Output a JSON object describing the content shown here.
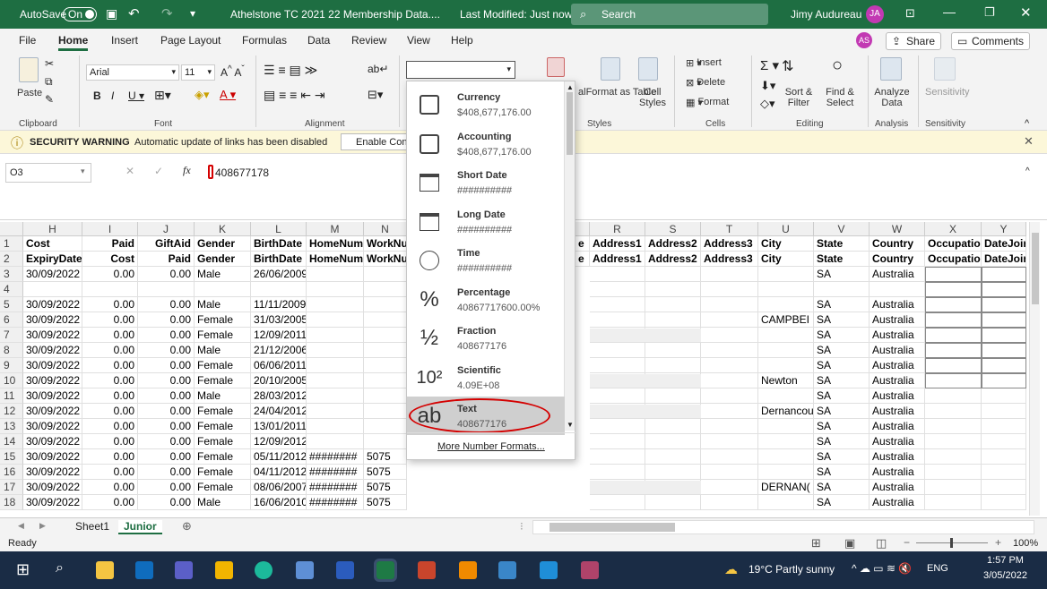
{
  "titlebar": {
    "autosave": "AutoSave",
    "toggle": "On",
    "doc_title": "Athelstone TC 2021 22 Membership Data....",
    "status": "Last Modified: Just now",
    "search": "Search",
    "user": "Jimy Audureau",
    "user_initials": "JA"
  },
  "menu": {
    "items": [
      "File",
      "Home",
      "Insert",
      "Page Layout",
      "Formulas",
      "Data",
      "Review",
      "View",
      "Help"
    ],
    "user_initials": "AS",
    "share": "Share",
    "comments": "Comments"
  },
  "ribbon": {
    "paste": "Paste",
    "font": "Arial",
    "size": "11",
    "insert": "Insert",
    "delete": "Delete",
    "format": "Format",
    "format_as_table": "Format as Table",
    "cell_styles": "Cell Styles",
    "sort_filter": "Sort & Filter",
    "find_select": "Find & Select",
    "analyze": "Analyze Data",
    "sensitivity": "Sensitivity",
    "groups": [
      "Clipboard",
      "Font",
      "Alignment",
      "Styles",
      "Cells",
      "Editing",
      "Analysis",
      "Sensitivity"
    ]
  },
  "warning": {
    "title": "SECURITY WARNING",
    "message": "Automatic update of links has been disabled",
    "button": "Enable Cont"
  },
  "formula": {
    "namebox": "O3",
    "fx": "fx",
    "value": "408677178"
  },
  "columns": [
    "H",
    "I",
    "J",
    "K",
    "L",
    "M",
    "N",
    "R",
    "S",
    "T",
    "U",
    "V",
    "W",
    "X",
    "Y"
  ],
  "rows": [
    {
      "n": "1",
      "c": [
        "Cost",
        "Paid",
        "GiftAid",
        "Gender",
        "BirthDate",
        "HomeNum",
        "WorkNu",
        "Address1",
        "Address2",
        "Address3",
        "City",
        "State",
        "Country",
        "Occupation",
        "DateJoir"
      ],
      "e": "e"
    },
    {
      "n": "2",
      "c": [
        "ExpiryDate",
        "Cost",
        "Paid",
        "Gender",
        "BirthDate",
        "HomeNum",
        "WorkNu",
        "Address1",
        "Address2",
        "Address3",
        "City",
        "State",
        "Country",
        "Occupation",
        "DateJoir"
      ],
      "e": "e"
    },
    {
      "n": "3",
      "c": [
        "30/09/2022",
        "0.00",
        "0.00",
        "Male",
        "26/06/2009",
        "",
        "",
        "",
        "",
        "",
        "",
        "SA",
        "Australia",
        "",
        ""
      ]
    },
    {
      "n": "4",
      "c": [
        "",
        "",
        "",
        "",
        "",
        "",
        "",
        "",
        "",
        "",
        "",
        "",
        "",
        "",
        ""
      ]
    },
    {
      "n": "5",
      "c": [
        "30/09/2022",
        "0.00",
        "0.00",
        "Male",
        "11/11/2009",
        "",
        "",
        "",
        "",
        "",
        "",
        "SA",
        "Australia",
        "",
        ""
      ]
    },
    {
      "n": "6",
      "c": [
        "30/09/2022",
        "0.00",
        "0.00",
        "Female",
        "31/03/2005",
        "",
        "",
        "",
        "",
        "",
        "CAMPBEI",
        "SA",
        "Australia",
        "",
        ""
      ]
    },
    {
      "n": "7",
      "c": [
        "30/09/2022",
        "0.00",
        "0.00",
        "Female",
        "12/09/2011",
        "",
        "",
        "",
        "",
        "",
        "",
        "SA",
        "Australia",
        "",
        ""
      ]
    },
    {
      "n": "8",
      "c": [
        "30/09/2022",
        "0.00",
        "0.00",
        "Male",
        "21/12/2006",
        "",
        "",
        "",
        "",
        "",
        "",
        "SA",
        "Australia",
        "",
        ""
      ]
    },
    {
      "n": "9",
      "c": [
        "30/09/2022",
        "0.00",
        "0.00",
        "Female",
        "06/06/2011",
        "",
        "",
        "",
        "",
        "",
        "",
        "SA",
        "Australia",
        "",
        ""
      ]
    },
    {
      "n": "10",
      "c": [
        "30/09/2022",
        "0.00",
        "0.00",
        "Female",
        "20/10/2005",
        "",
        "",
        "",
        "",
        "",
        "Newton",
        "SA",
        "Australia",
        "",
        ""
      ]
    },
    {
      "n": "11",
      "c": [
        "30/09/2022",
        "0.00",
        "0.00",
        "Male",
        "28/03/2012",
        "",
        "",
        "",
        "",
        "",
        "",
        "SA",
        "Australia",
        "",
        ""
      ]
    },
    {
      "n": "12",
      "c": [
        "30/09/2022",
        "0.00",
        "0.00",
        "Female",
        "24/04/2012",
        "",
        "",
        "",
        "",
        "",
        "Dernancou",
        "SA",
        "Australia",
        "",
        ""
      ]
    },
    {
      "n": "13",
      "c": [
        "30/09/2022",
        "0.00",
        "0.00",
        "Female",
        "13/01/2011",
        "",
        "",
        "",
        "",
        "",
        "",
        "SA",
        "Australia",
        "",
        ""
      ]
    },
    {
      "n": "14",
      "c": [
        "30/09/2022",
        "0.00",
        "0.00",
        "Female",
        "12/09/2012",
        "",
        "",
        "",
        "",
        "",
        "",
        "SA",
        "Australia",
        "",
        ""
      ]
    },
    {
      "n": "15",
      "c": [
        "30/09/2022",
        "0.00",
        "0.00",
        "Female",
        "05/11/2012",
        "########",
        "5075",
        "",
        "",
        "",
        "",
        "SA",
        "Australia",
        "",
        ""
      ]
    },
    {
      "n": "16",
      "c": [
        "30/09/2022",
        "0.00",
        "0.00",
        "Female",
        "04/11/2012",
        "########",
        "5075",
        "",
        "",
        "",
        "",
        "SA",
        "Australia",
        "",
        ""
      ]
    },
    {
      "n": "17",
      "c": [
        "30/09/2022",
        "0.00",
        "0.00",
        "Female",
        "08/06/2007",
        "########",
        "5075",
        "",
        "",
        "",
        "DERNAN(",
        "SA",
        "Australia",
        "",
        ""
      ]
    },
    {
      "n": "18",
      "c": [
        "30/09/2022",
        "0.00",
        "0.00",
        "Male",
        "16/06/2010",
        "########",
        "5075",
        "",
        "",
        "",
        "",
        "SA",
        "Australia",
        "",
        ""
      ]
    }
  ],
  "numfmt": [
    {
      "name": "Currency",
      "value": "$408,677,176.00",
      "icon": "currency-icon"
    },
    {
      "name": "Accounting",
      "value": "$408,677,176.00",
      "icon": "accounting-icon"
    },
    {
      "name": "Short Date",
      "value": "##########",
      "icon": "calendar-icon"
    },
    {
      "name": "Long Date",
      "value": "##########",
      "icon": "calendar-icon"
    },
    {
      "name": "Time",
      "value": "##########",
      "icon": "clock-icon"
    },
    {
      "name": "Percentage",
      "value": "40867717600.00%",
      "icon": "percent-icon"
    },
    {
      "name": "Fraction",
      "value": "408677176",
      "icon": "fraction-icon"
    },
    {
      "name": "Scientific",
      "value": "4.09E+08",
      "icon": "scientific-icon"
    },
    {
      "name": "Text",
      "value": "408677176",
      "icon": "text-ab-icon"
    }
  ],
  "numfmt_glyphs": [
    "%",
    "½",
    "10²",
    "ab"
  ],
  "more_formats": "More Number Formats...",
  "sheets": [
    "Sheet1",
    "Junior"
  ],
  "status": {
    "ready": "Ready",
    "zoom": "100%"
  },
  "taskbar": {
    "weather": "19°C  Partly sunny",
    "lang": "ENG",
    "time": "1:57 PM",
    "date": "3/05/2022"
  },
  "colors": {
    "excel_green": "#1e6e42",
    "highlight": "#d40000"
  }
}
